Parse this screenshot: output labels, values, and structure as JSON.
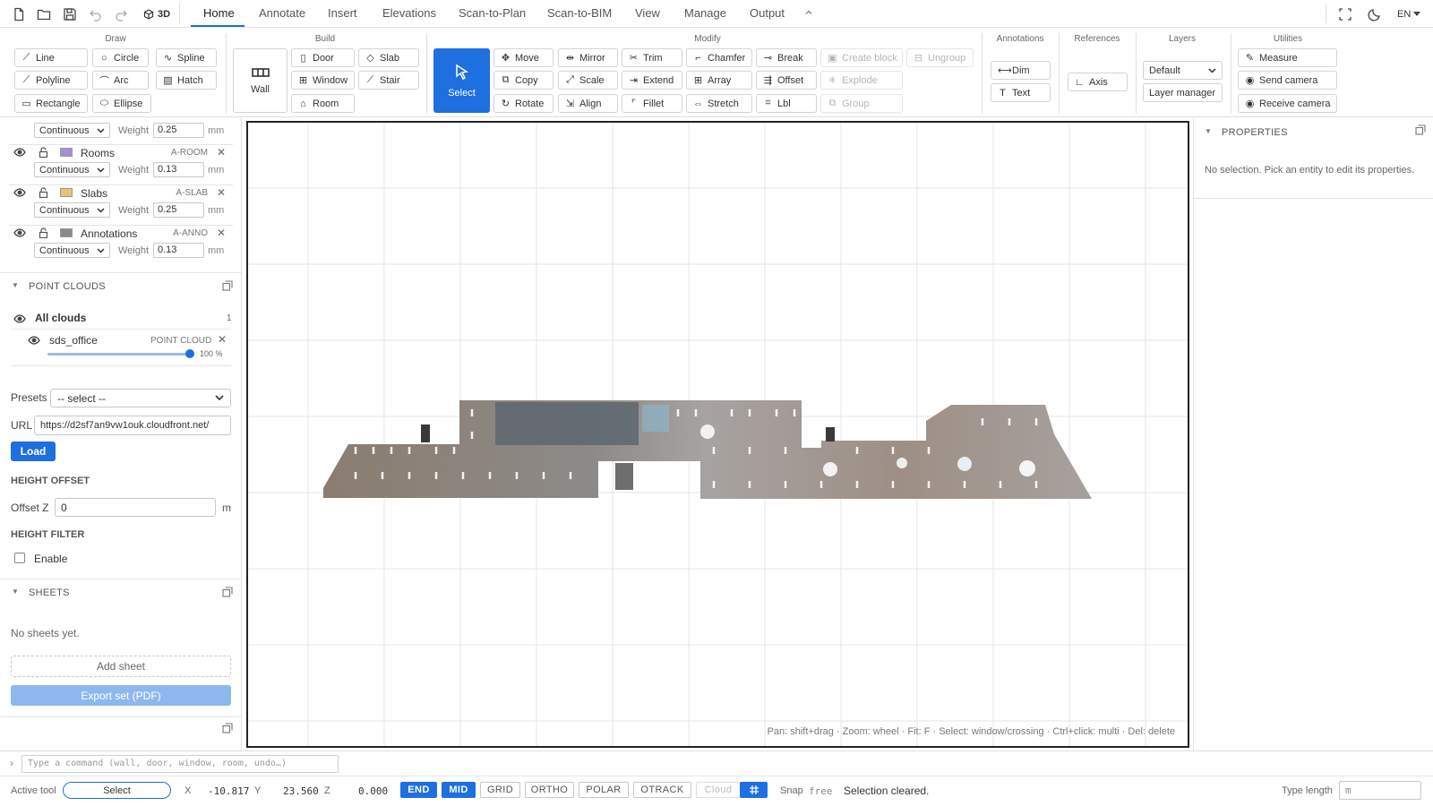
{
  "quick_access": {
    "three_d_label": "3D"
  },
  "tabs": [
    {
      "label": "Home",
      "active": true
    },
    {
      "label": "Annotate"
    },
    {
      "label": "Insert"
    },
    {
      "label": "Elevations"
    },
    {
      "label": "Scan-to-Plan"
    },
    {
      "label": "Scan-to-BIM"
    },
    {
      "label": "View"
    },
    {
      "label": "Manage"
    },
    {
      "label": "Output"
    }
  ],
  "language": "EN",
  "ribbon": {
    "draw": {
      "title": "Draw",
      "buttons": [
        "Line",
        "Circle",
        "Spline",
        "Polyline",
        "Arc",
        "Hatch",
        "Rectangle",
        "Ellipse"
      ]
    },
    "build": {
      "title": "Build",
      "wall": "Wall",
      "buttons": [
        "Door",
        "Slab",
        "Window",
        "Stair",
        "Room"
      ]
    },
    "select": "Select",
    "modify": {
      "title": "Modify",
      "buttons": [
        "Move",
        "Mirror",
        "Trim",
        "Chamfer",
        "Break",
        "Create block",
        "Ungroup",
        "Copy",
        "Scale",
        "Extend",
        "Array",
        "Offset",
        "Explode",
        "Rotate",
        "Align",
        "Fillet",
        "Stretch",
        "Lbl",
        "Group"
      ]
    },
    "annotations": {
      "title": "Annotations",
      "buttons": [
        "Dim",
        "Text"
      ]
    },
    "references": {
      "title": "References",
      "buttons": [
        "Axis"
      ]
    },
    "layers": {
      "title": "Layers",
      "select_value": "Default",
      "manager": "Layer manager"
    },
    "utilities": {
      "title": "Utilities",
      "buttons": [
        "Measure",
        "Send camera",
        "Receive camera"
      ]
    }
  },
  "layers_panel": {
    "weight_label": "Weight",
    "unit": "mm",
    "first_row": {
      "linetype": "Continuous",
      "weight": "0.25"
    },
    "layers": [
      {
        "name": "Rooms",
        "code": "A-ROOM",
        "color": "#a48fd6",
        "linetype": "Continuous",
        "weight": "0.13"
      },
      {
        "name": "Slabs",
        "code": "A-SLAB",
        "color": "#e9c46a",
        "linetype": "Continuous",
        "weight": "0.25"
      },
      {
        "name": "Annotations",
        "code": "A-ANNO",
        "color": "#8a8a8a",
        "linetype": "Continuous",
        "weight": "0.13"
      }
    ]
  },
  "point_clouds": {
    "title": "POINT CLOUDS",
    "all_label": "All clouds",
    "count": "1",
    "item": {
      "name": "sds_office",
      "type": "POINT CLOUD",
      "opacity": "100 %",
      "opacity_value": 1.0
    },
    "presets_label": "Presets",
    "presets_value": "-- select --",
    "url_label": "URL",
    "url_value": "https://d2sf7an9vw1ouk.cloudfront.net/",
    "load": "Load",
    "height_offset_title": "HEIGHT OFFSET",
    "offset_label": "Offset Z",
    "offset_value": "0",
    "offset_unit": "m",
    "height_filter_title": "HEIGHT FILTER",
    "enable_label": "Enable"
  },
  "sheets": {
    "title": "SHEETS",
    "empty": "No sheets yet.",
    "add": "Add sheet",
    "export": "Export set (PDF)"
  },
  "canvas": {
    "hint": "Pan: shift+drag · Zoom: wheel · Fit: F · Select: window/crossing · Ctrl+click: multi · Del: delete"
  },
  "properties": {
    "title": "PROPERTIES",
    "empty": "No selection. Pick an entity to edit its properties."
  },
  "command": {
    "prompt": "›",
    "placeholder": "Type a command (wall, door, window, room, undo…)"
  },
  "status": {
    "active_tool_label": "Active tool",
    "active_tool": "Select",
    "x_label": "X",
    "x": "-10.817",
    "y_label": "Y",
    "y": "23.560",
    "z_label": "Z",
    "z": "0.000",
    "snaps": [
      {
        "label": "END",
        "state": "on"
      },
      {
        "label": "MID",
        "state": "on"
      },
      {
        "label": "GRID",
        "state": "normal"
      },
      {
        "label": "ORTHO",
        "state": "normal"
      },
      {
        "label": "POLAR",
        "state": "normal"
      },
      {
        "label": "OTRACK",
        "state": "normal"
      },
      {
        "label": "Cloud",
        "state": "off"
      }
    ],
    "snap_label": "Snap",
    "snap_mode": "free",
    "message": "Selection cleared.",
    "type_length_label": "Type length",
    "type_length_value": "m"
  },
  "colors": {
    "accent": "#1e6fe0",
    "canvas_border": "#222222",
    "grid": "#e6e6e6"
  },
  "icons": [
    "new-file-icon",
    "open-folder-icon",
    "save-icon",
    "undo-icon",
    "redo-icon",
    "cube-icon",
    "chevron-up-icon",
    "fullscreen-icon",
    "moon-icon",
    "cursor-arrow-icon",
    "eye-icon",
    "lock-icon",
    "popout-icon"
  ]
}
